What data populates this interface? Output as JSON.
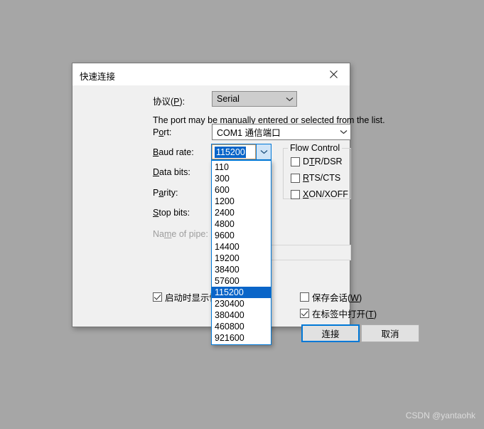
{
  "desktop": {
    "background_color": "#a6a6a6",
    "watermark": "CSDN @yantaohk"
  },
  "dialog": {
    "title": "快速连接",
    "close_icon": "close-icon",
    "hint_text": "The port may be manually entered or selected from the list.",
    "fields": {
      "protocol": {
        "label_prefix": "协议(",
        "label_accelerator": "P",
        "label_suffix": "):",
        "value": "Serial",
        "enabled": true
      },
      "port": {
        "label_prefix": "P",
        "label_accelerator": "o",
        "label_suffix": "rt:",
        "value": "COM1 通信端口",
        "enabled": true
      },
      "baud_rate": {
        "label_prefix": "",
        "label_accelerator": "B",
        "label_suffix": "aud rate:",
        "value": "115200",
        "selected_text": "115200",
        "dropdown_open": true,
        "options": [
          "110",
          "300",
          "600",
          "1200",
          "2400",
          "4800",
          "9600",
          "14400",
          "19200",
          "38400",
          "57600",
          "115200",
          "230400",
          "380400",
          "460800",
          "921600"
        ],
        "selected_option": "115200"
      },
      "data_bits": {
        "label_prefix": "",
        "label_accelerator": "D",
        "label_suffix": "ata bits:"
      },
      "parity": {
        "label_prefix": "P",
        "label_accelerator": "a",
        "label_suffix": "rity:"
      },
      "stop_bits": {
        "label_prefix": "",
        "label_accelerator": "S",
        "label_suffix": "top bits:"
      },
      "name_of_pipe": {
        "label_prefix": "Na",
        "label_accelerator": "m",
        "label_suffix": "e of pipe:",
        "value": "",
        "enabled": false
      }
    },
    "flow_control": {
      "legend": "Flow Control",
      "items": [
        {
          "prefix": "D",
          "accelerator": "T",
          "suffix": "R/DSR",
          "checked": false
        },
        {
          "prefix": "",
          "accelerator": "R",
          "suffix": "TS/CTS",
          "checked": false
        },
        {
          "prefix": "",
          "accelerator": "X",
          "suffix": "ON/XOFF",
          "checked": false
        }
      ]
    },
    "options": {
      "show_on_startup": {
        "label": "启动时显示快速连接(S)",
        "checked": true
      },
      "save_session": {
        "label_prefix": "保存会话(",
        "label_accelerator": "W",
        "label_suffix": ")",
        "checked": false
      },
      "open_in_tab": {
        "label_prefix": "在标签中打开(",
        "label_accelerator": "T",
        "label_suffix": ")",
        "checked": true
      }
    },
    "buttons": {
      "connect": "连接",
      "cancel": "取消"
    },
    "colors": {
      "accent": "#0078d7",
      "selection": "#0a65c8",
      "dialog_bg": "#f0f0f0"
    }
  }
}
